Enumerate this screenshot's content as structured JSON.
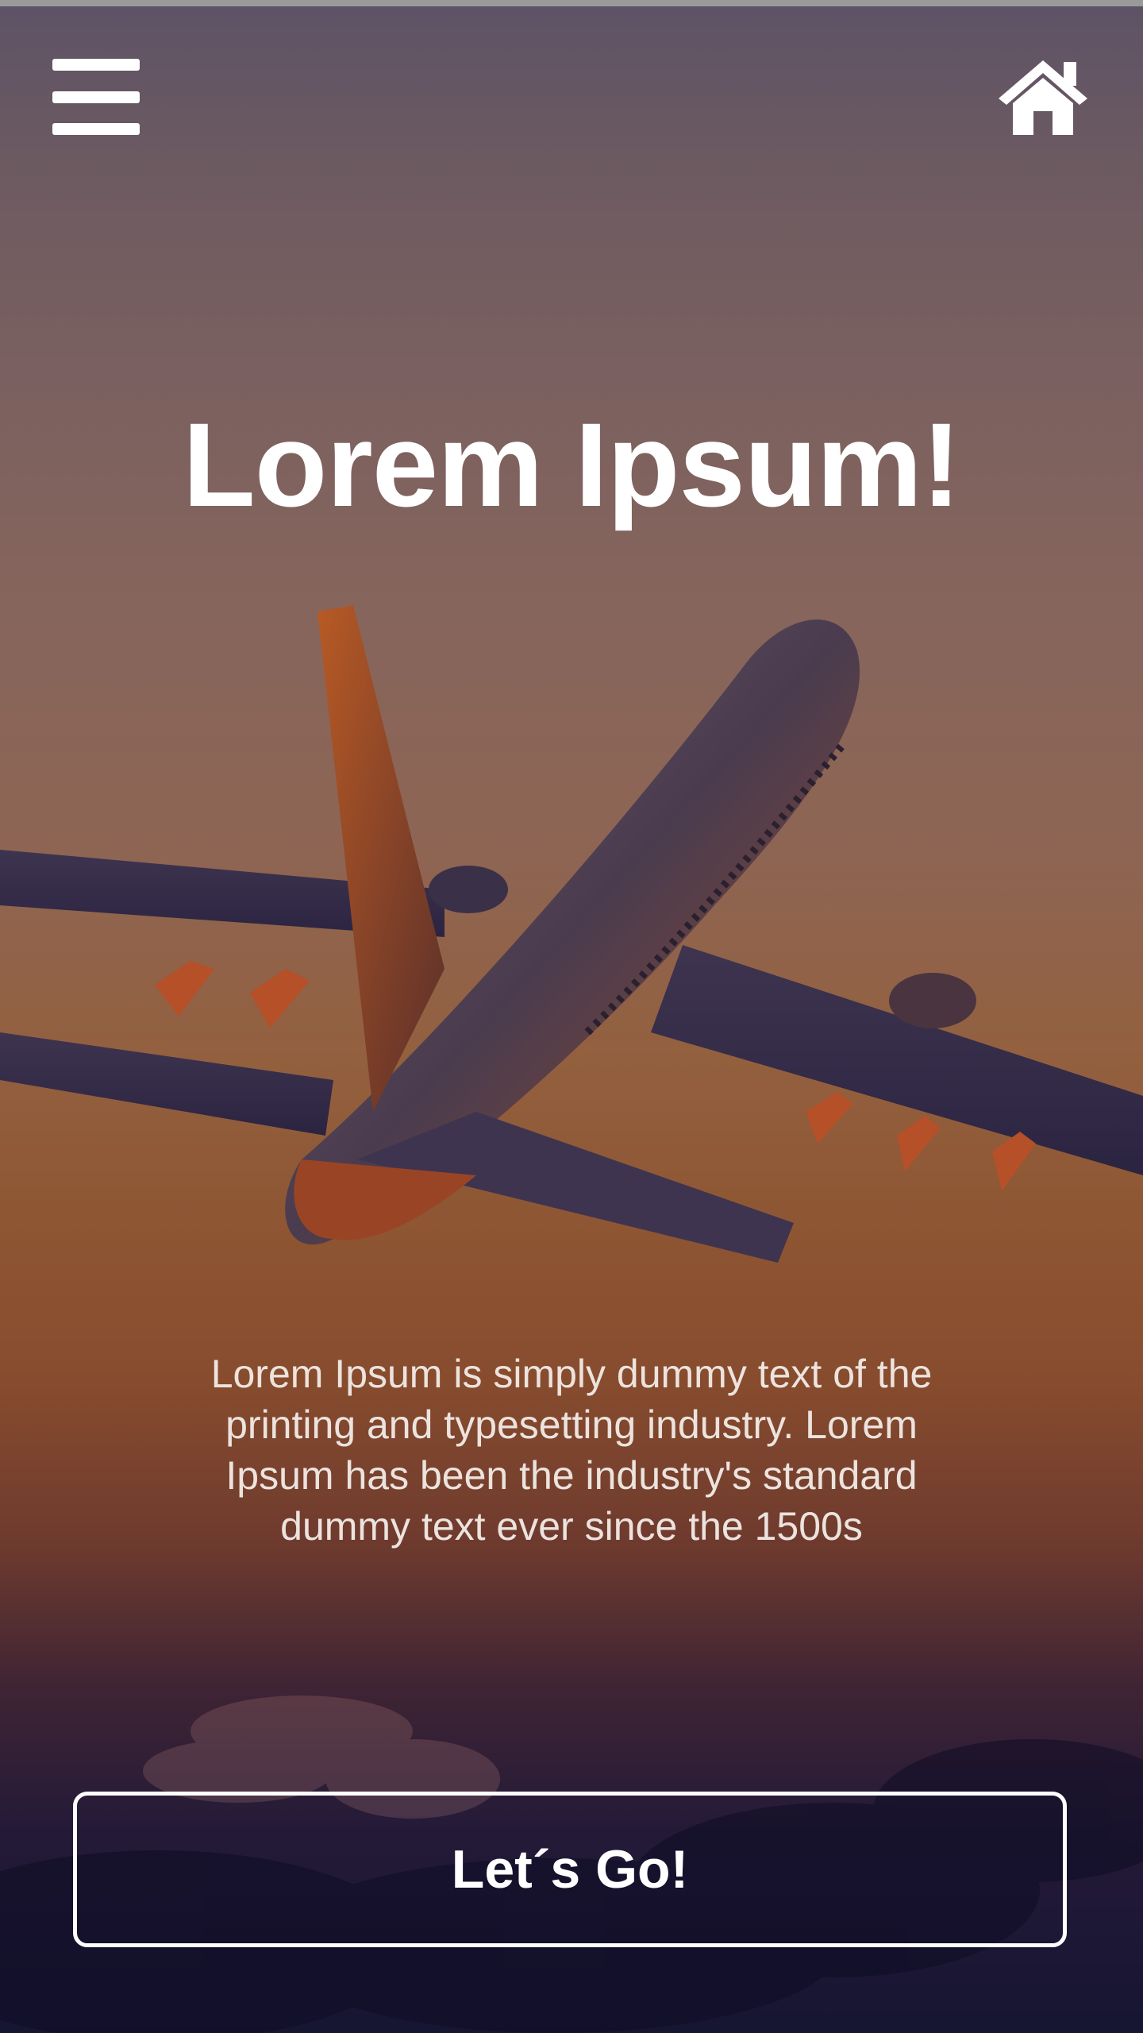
{
  "header": {
    "menu_icon": "hamburger-menu-icon",
    "home_icon": "home-icon"
  },
  "hero": {
    "title": "Lorem Ipsum!",
    "description": "Lorem Ipsum is simply dummy text of the printing and typesetting industry. Lorem Ipsum has been the industry's standard dummy text ever since the 1500s"
  },
  "cta": {
    "label": "Let´s Go!"
  },
  "colors": {
    "text": "#ffffff",
    "sky_top": "#5d5266",
    "sky_mid": "#93603f",
    "sky_bottom": "#161532"
  }
}
